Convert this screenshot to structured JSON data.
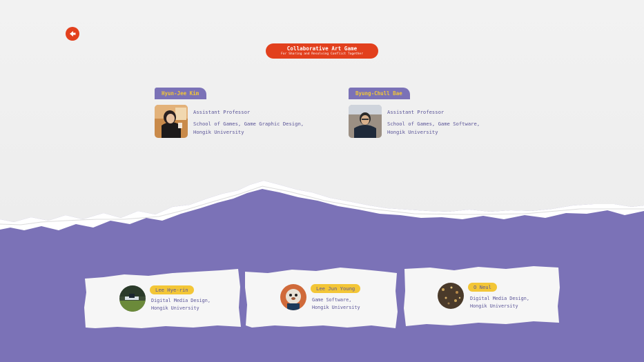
{
  "header": {
    "back_icon": "arrow-left-icon",
    "title": "Collaborative Art Game",
    "subtitle": "For Sharing and Resolving Conflict Together"
  },
  "colors": {
    "accent_red": "#e2401d",
    "purple": "#7b72b7",
    "yellow": "#f3c637",
    "text_purple": "#5b5598"
  },
  "professors": [
    {
      "name": "Hyun-Jee Kim",
      "role": "Assistant Professor",
      "dept_line1": "School of Games, Game Graphic Design,",
      "dept_line2": "Hongik University"
    },
    {
      "name": "Byung-Chull Bae",
      "role": "Assistant Professor",
      "dept_line1": "School of Games, Game Software,",
      "dept_line2": "Hongik University"
    }
  ],
  "students": [
    {
      "name": "Lee Hye-rin",
      "dept_line1": "Digital Media Design,",
      "dept_line2": "Hongik University"
    },
    {
      "name": "Lee Jun Young",
      "dept_line1": "Game Software,",
      "dept_line2": "Hongik University"
    },
    {
      "name": "O Neul",
      "dept_line1": "Digital Media Design,",
      "dept_line2": "Hongik University"
    }
  ]
}
